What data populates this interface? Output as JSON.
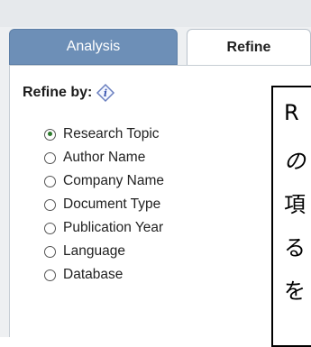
{
  "tabs": [
    {
      "label": "Analysis",
      "active": false
    },
    {
      "label": "Refine",
      "active": true
    }
  ],
  "refine": {
    "heading": "Refine by:",
    "options": [
      {
        "label": "Research Topic",
        "selected": true
      },
      {
        "label": "Author Name",
        "selected": false
      },
      {
        "label": "Company Name",
        "selected": false
      },
      {
        "label": "Document Type",
        "selected": false
      },
      {
        "label": "Publication Year",
        "selected": false
      },
      {
        "label": "Language",
        "selected": false
      },
      {
        "label": "Database",
        "selected": false
      }
    ]
  },
  "tooltip": {
    "lines": [
      "R",
      "の",
      "項",
      "る",
      "を"
    ]
  },
  "colors": {
    "analysis_tab": "#6d8fb7",
    "panel_bg": "#eef0f2",
    "radio_checked": "#2c7a2c"
  },
  "icons": {
    "help": "help-diamond-icon"
  }
}
